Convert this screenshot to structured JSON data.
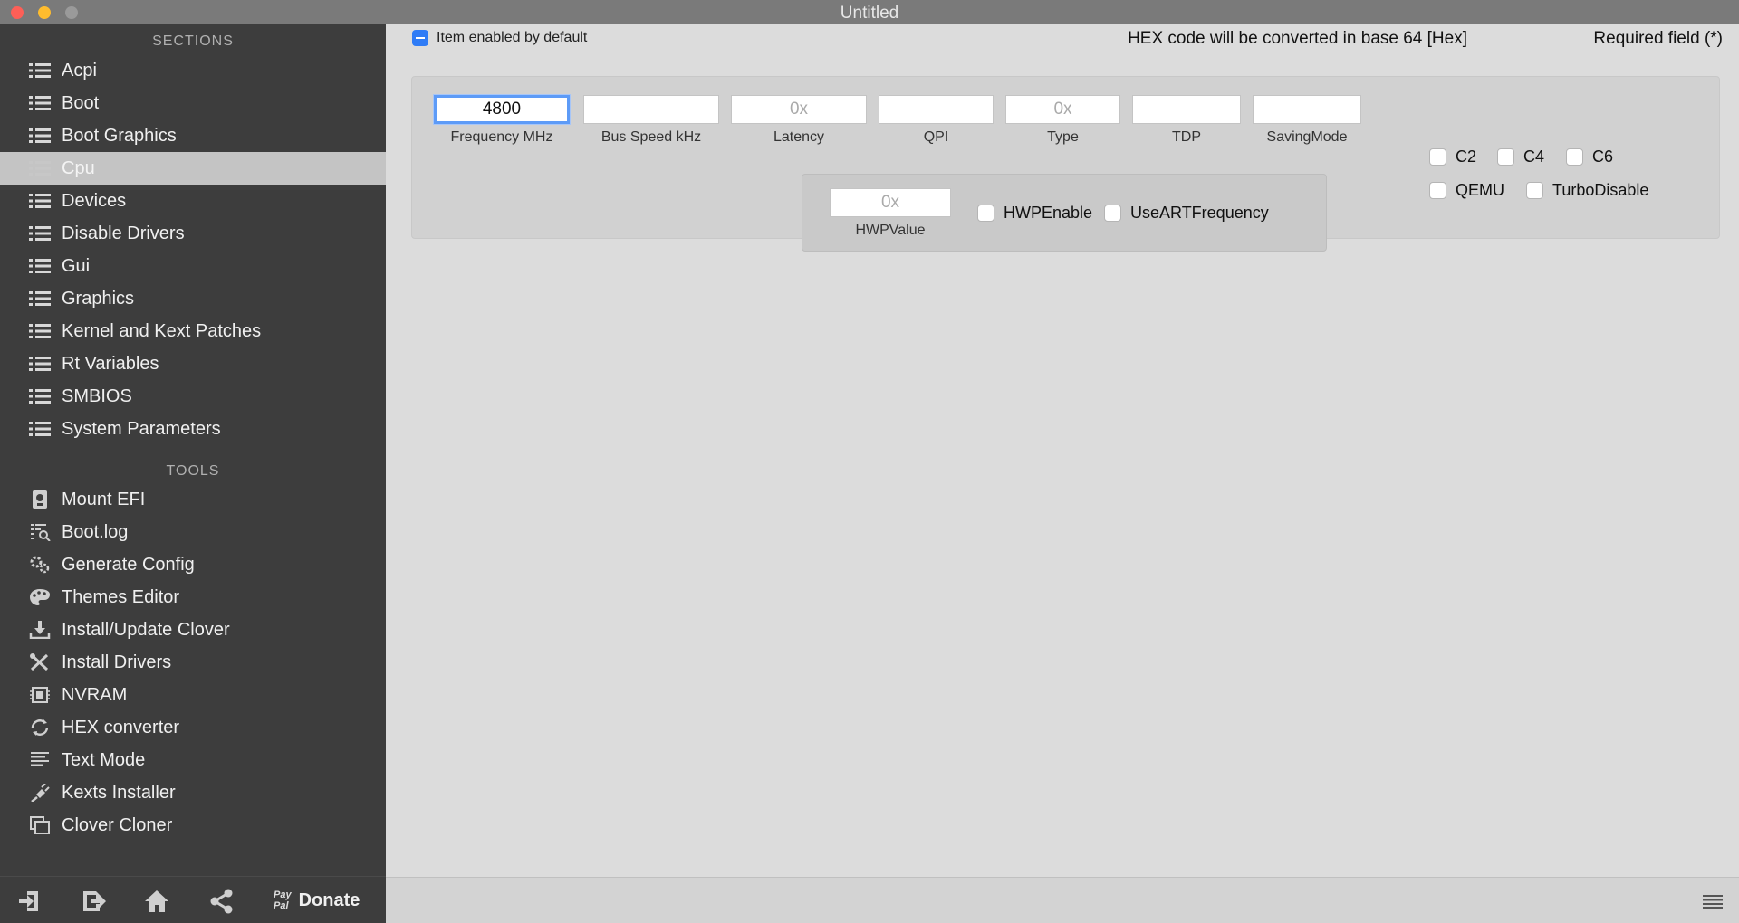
{
  "window": {
    "title": "Untitled"
  },
  "sidebar": {
    "sections_header": "SECTIONS",
    "sections": [
      {
        "label": "Acpi",
        "icon": "list-icon"
      },
      {
        "label": "Boot",
        "icon": "list-icon"
      },
      {
        "label": "Boot Graphics",
        "icon": "list-icon"
      },
      {
        "label": "Cpu",
        "icon": "list-icon",
        "selected": true
      },
      {
        "label": "Devices",
        "icon": "list-icon"
      },
      {
        "label": "Disable Drivers",
        "icon": "list-icon"
      },
      {
        "label": "Gui",
        "icon": "list-icon"
      },
      {
        "label": "Graphics",
        "icon": "list-icon"
      },
      {
        "label": "Kernel and Kext Patches",
        "icon": "list-icon"
      },
      {
        "label": "Rt Variables",
        "icon": "list-icon"
      },
      {
        "label": "SMBIOS",
        "icon": "list-icon"
      },
      {
        "label": "System Parameters",
        "icon": "list-icon"
      }
    ],
    "tools_header": "TOOLS",
    "tools": [
      {
        "label": "Mount EFI",
        "icon": "disk-icon"
      },
      {
        "label": "Boot.log",
        "icon": "log-search-icon"
      },
      {
        "label": "Generate Config",
        "icon": "gears-icon"
      },
      {
        "label": "Themes Editor",
        "icon": "palette-icon"
      },
      {
        "label": "Install/Update Clover",
        "icon": "download-icon"
      },
      {
        "label": "Install Drivers",
        "icon": "tools-icon"
      },
      {
        "label": "NVRAM",
        "icon": "chip-icon"
      },
      {
        "label": "HEX converter",
        "icon": "refresh-icon"
      },
      {
        "label": "Text Mode",
        "icon": "text-lines-icon"
      },
      {
        "label": "Kexts Installer",
        "icon": "plug-icon"
      },
      {
        "label": "Clover Cloner",
        "icon": "copy-icon"
      }
    ],
    "donate_paypal": "Pay\nPal",
    "donate_label": "Donate"
  },
  "main": {
    "enabled_label": "Item enabled by default",
    "hex_note": "HEX code will be converted in base 64 [Hex]",
    "required_note": "Required field (*)",
    "fields": {
      "frequency": {
        "label": "Frequency MHz",
        "value": "4800",
        "placeholder": ""
      },
      "bus_speed": {
        "label": "Bus Speed kHz",
        "value": "",
        "placeholder": ""
      },
      "latency": {
        "label": "Latency",
        "value": "",
        "placeholder": "0x"
      },
      "qpi": {
        "label": "QPI",
        "value": "",
        "placeholder": ""
      },
      "type": {
        "label": "Type",
        "value": "",
        "placeholder": "0x"
      },
      "tdp": {
        "label": "TDP",
        "value": "",
        "placeholder": ""
      },
      "saving_mode": {
        "label": "SavingMode",
        "value": "",
        "placeholder": ""
      },
      "hwp_value": {
        "label": "HWPValue",
        "value": "",
        "placeholder": "0x"
      }
    },
    "checkboxes": {
      "hwp_enable": "HWPEnable",
      "use_art_frequency": "UseARTFrequency",
      "c2": "C2",
      "c4": "C4",
      "c6": "C6",
      "qemu": "QEMU",
      "turbo_disable": "TurboDisable"
    }
  },
  "colors": {
    "accent": "#2f7cf6",
    "sidebar_bg": "#3d3d3d",
    "selected_bg": "#c4c4c4",
    "close": "#fd5f57",
    "minimize": "#febc2e"
  }
}
